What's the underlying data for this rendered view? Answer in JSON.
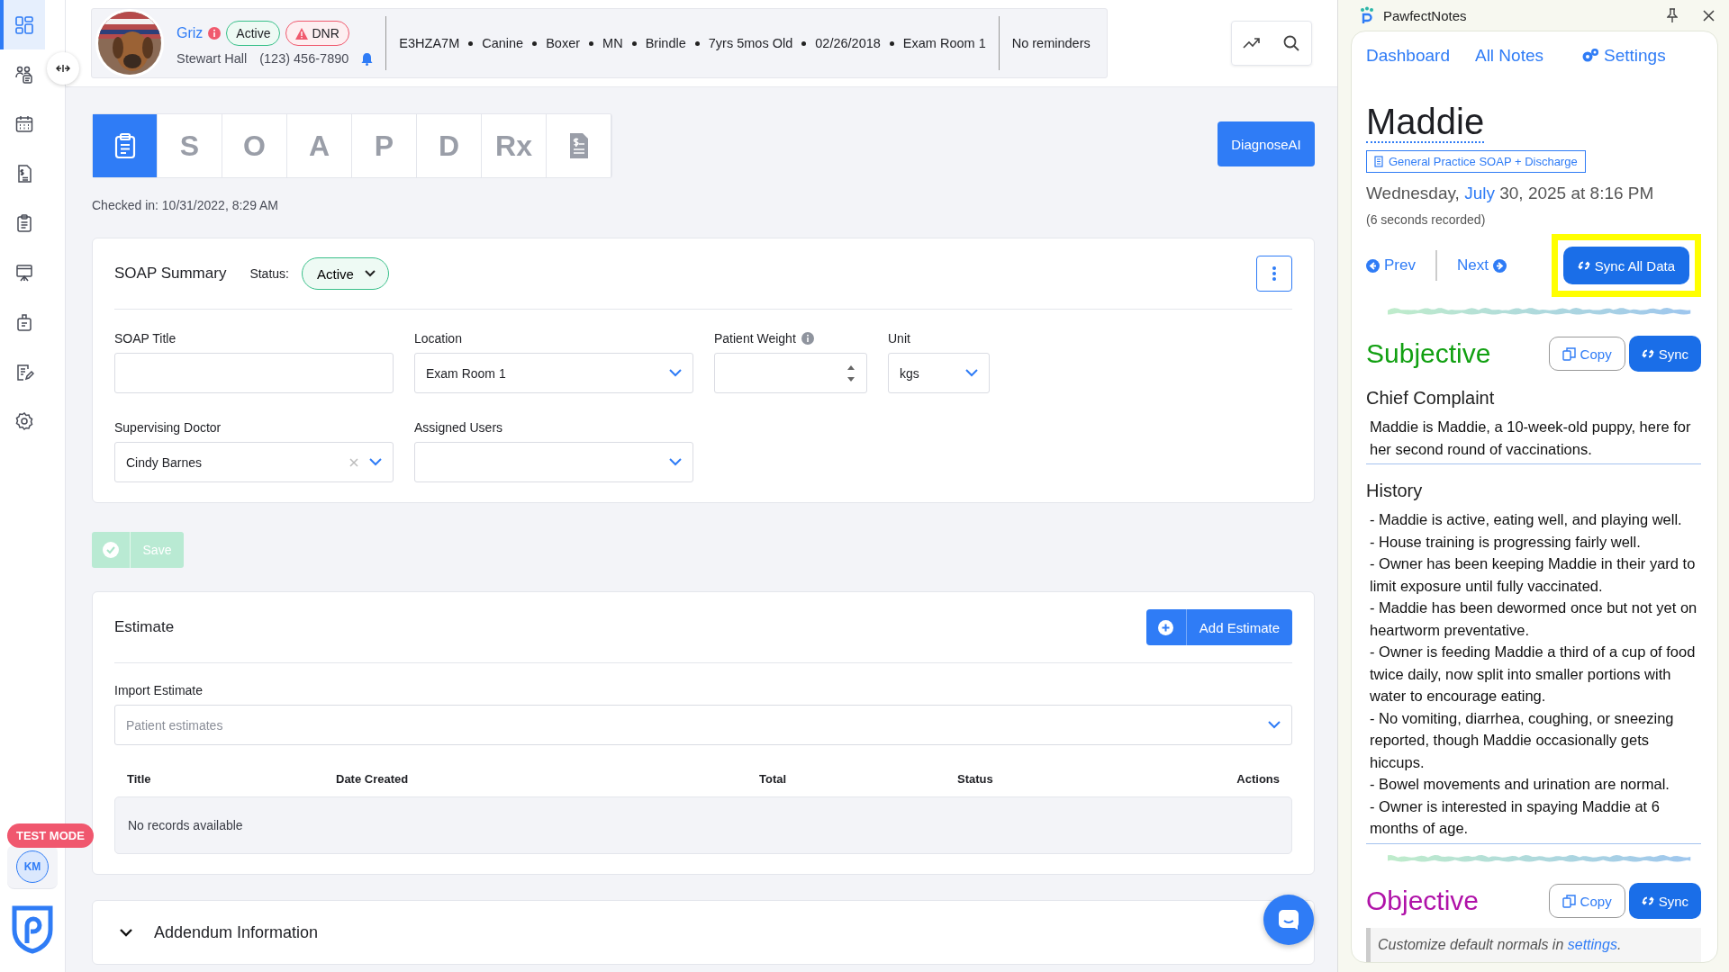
{
  "sidebar": {
    "items": [
      {
        "kind": "dashboard",
        "selected": true
      },
      {
        "kind": "people",
        "selected": false
      },
      {
        "kind": "calendar",
        "selected": false
      },
      {
        "kind": "invoice",
        "selected": false
      },
      {
        "kind": "clipboard",
        "selected": false
      },
      {
        "kind": "easel",
        "selected": false
      },
      {
        "kind": "bag",
        "selected": false
      },
      {
        "kind": "note",
        "selected": false
      },
      {
        "kind": "settings",
        "selected": false
      }
    ],
    "test_mode": "TEST MODE",
    "user_initials": "KM"
  },
  "patient": {
    "name": "Griz",
    "badges": [
      {
        "label": "Active",
        "kind": "active"
      },
      {
        "label": "DNR",
        "kind": "alert"
      }
    ],
    "owner": "Stewart Hall",
    "phone": "(123) 456-7890",
    "details": [
      "E3HZA7M",
      "Canine",
      "Boxer",
      "MN",
      "Brindle",
      "7yrs 5mos Old",
      "02/26/2018",
      "Exam Room 1"
    ],
    "reminders": "No reminders"
  },
  "soap_tabs": [
    {
      "kind": "clipboard",
      "selected": true
    },
    {
      "kind": "letter",
      "label": "S",
      "selected": false
    },
    {
      "kind": "letter",
      "label": "O",
      "selected": false
    },
    {
      "kind": "letter",
      "label": "A",
      "selected": false
    },
    {
      "kind": "letter",
      "label": "P",
      "selected": false
    },
    {
      "kind": "letter",
      "label": "D",
      "selected": false
    },
    {
      "kind": "letter",
      "label": "Rx",
      "selected": false
    },
    {
      "kind": "invoice",
      "selected": false
    }
  ],
  "diagnose_button": "DiagnoseAI",
  "checked_in": "Checked in: 10/31/2022, 8:29 AM",
  "soap_summary": {
    "title": "SOAP Summary",
    "status_label": "Status:",
    "status": "Active",
    "fields": [
      {
        "label": "SOAP Title",
        "kind": "text"
      },
      {
        "label": "Location",
        "kind": "select",
        "value": "Exam Room 1"
      },
      {
        "label": "Patient Weight",
        "kind": "number"
      },
      {
        "label": "Unit",
        "kind": "select",
        "value": "kgs"
      },
      {
        "label": "Supervising Doctor",
        "kind": "select",
        "value": "Cindy Barnes",
        "clearable": true
      },
      {
        "label": "Assigned Users",
        "kind": "select"
      }
    ]
  },
  "save_button": {
    "label": "Save",
    "disabled": true
  },
  "estimate": {
    "title": "Estimate",
    "add_button": "Add Estimate",
    "import_label": "Import Estimate",
    "import_placeholder": "Patient estimates",
    "columns": [
      "Title",
      "Date Created",
      "Total",
      "Status",
      "Actions"
    ],
    "empty": "No records available"
  },
  "addendum": {
    "title": "Addendum Information"
  },
  "notes_panel": {
    "app_title": "PawfectNotes",
    "nav": [
      {
        "label": "Dashboard",
        "kind": "plain"
      },
      {
        "label": "All Notes",
        "kind": "plain"
      },
      {
        "label": "Settings",
        "kind": "gear"
      }
    ],
    "patient": "Maddie",
    "template": "General Practice SOAP + Discharge",
    "date": {
      "weekday": "Wednesday,",
      "month": "July",
      "rest": "30, 2025 at 8:16 PM"
    },
    "recorded": "(6 seconds recorded)",
    "prev": "Prev",
    "next": "Next",
    "sync_all": {
      "label": "Sync All Data",
      "highlighted": true
    },
    "sections": [
      {
        "title": "Subjective",
        "color": "#12a012",
        "copy": "Copy",
        "sync": "Sync",
        "blocks": [
          {
            "heading": "Chief Complaint",
            "paragraphs": [
              "Maddie is Maddie, a 10-week-old puppy, here for her second round of vaccinations."
            ]
          },
          {
            "heading": "History",
            "paragraphs": [
              "- Maddie is active, eating well, and playing well.",
              "- House training is progressing fairly well.",
              "- Owner has been keeping Maddie in their yard to limit exposure until fully vaccinated.",
              "- Maddie has been dewormed once but not yet on heartworm preventative.",
              "- Owner is feeding Maddie a third of a cup of food twice daily, now split into smaller portions with water to encourage eating.",
              "- No vomiting, diarrhea, coughing, or sneezing reported, though Maddie occasionally gets hiccups.",
              "- Bowel movements and urination are normal.",
              "- Owner is interested in spaying Maddie at 6 months of age."
            ]
          }
        ]
      },
      {
        "title": "Objective",
        "color": "#b012a8",
        "copy": "Copy",
        "sync": "Sync",
        "note": {
          "text": "Customize default normals in ",
          "link": "settings",
          "end": "."
        }
      }
    ]
  }
}
